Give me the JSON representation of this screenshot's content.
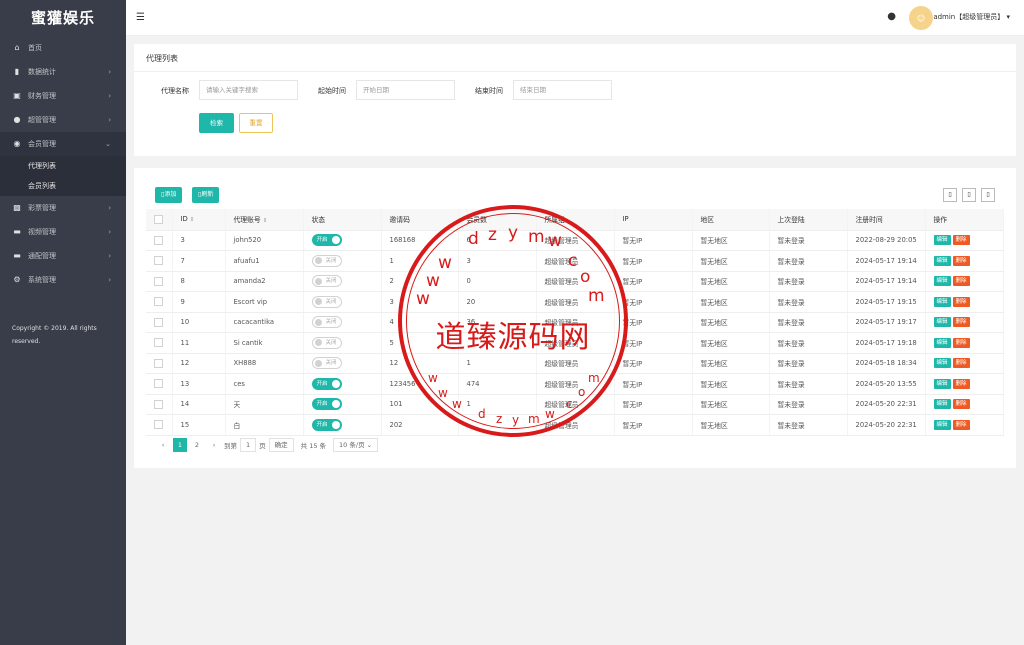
{
  "app": {
    "name": "蜜獾娱乐"
  },
  "sidebar": {
    "items": [
      {
        "label": "首页",
        "icon": "home-icon"
      },
      {
        "label": "数据统计",
        "icon": "bar-chart-icon"
      },
      {
        "label": "财务管理",
        "icon": "bank-icon"
      },
      {
        "label": "超管管理",
        "icon": "user-icon"
      },
      {
        "label": "会员管理",
        "icon": "users-icon"
      },
      {
        "label": "彩票管理",
        "icon": "gamepad-icon"
      },
      {
        "label": "视频管理",
        "icon": "video-icon"
      },
      {
        "label": "通配管理",
        "icon": "tag-icon"
      },
      {
        "label": "系统管理",
        "icon": "gear-icon"
      }
    ],
    "submenu": [
      "代理列表",
      "会员列表"
    ],
    "copyright": "Copyright © 2019. All rights reserved."
  },
  "header": {
    "user": "admin【超级管理员】"
  },
  "search": {
    "title": "代理列表",
    "name_label": "代理名称",
    "name_placeholder": "请输入关键字搜索",
    "start_label": "起始时间",
    "start_placeholder": "开始日期",
    "end_label": "结束时间",
    "end_placeholder": "结束日期",
    "search_btn": "检索",
    "reset_btn": "重置"
  },
  "toolbar": {
    "add": "添加",
    "refresh": "刷新"
  },
  "table": {
    "headers": [
      "ID",
      "代理账号",
      "状态",
      "邀请码",
      "会员数",
      "所属组",
      "IP",
      "地区",
      "上次登陆",
      "注册时间",
      "操作"
    ],
    "edit_label": "编辑",
    "delete_label": "删除",
    "rows": [
      {
        "id": "3",
        "account": "john520",
        "status": "开启",
        "on": true,
        "code": "168168",
        "members": "6",
        "group": "超级管理员",
        "ip": "暂无IP",
        "region": "暂无地区",
        "last": "暂未登录",
        "reg": "2022-08-29 20:05"
      },
      {
        "id": "7",
        "account": "afuafu1",
        "status": "关闭",
        "on": false,
        "code": "1",
        "members": "3",
        "group": "超级管理员",
        "ip": "暂无IP",
        "region": "暂无地区",
        "last": "暂未登录",
        "reg": "2024-05-17 19:14"
      },
      {
        "id": "8",
        "account": "amanda2",
        "status": "关闭",
        "on": false,
        "code": "2",
        "members": "0",
        "group": "超级管理员",
        "ip": "暂无IP",
        "region": "暂无地区",
        "last": "暂未登录",
        "reg": "2024-05-17 19:14"
      },
      {
        "id": "9",
        "account": "Escort vip",
        "status": "关闭",
        "on": false,
        "code": "3",
        "members": "20",
        "group": "超级管理员",
        "ip": "暂无IP",
        "region": "暂无地区",
        "last": "暂未登录",
        "reg": "2024-05-17 19:15"
      },
      {
        "id": "10",
        "account": "cacacantika",
        "status": "关闭",
        "on": false,
        "code": "4",
        "members": "36",
        "group": "超级管理员",
        "ip": "暂无IP",
        "region": "暂无地区",
        "last": "暂未登录",
        "reg": "2024-05-17 19:17"
      },
      {
        "id": "11",
        "account": "Si cantik",
        "status": "关闭",
        "on": false,
        "code": "5",
        "members": "",
        "group": "超级管理员",
        "ip": "暂无IP",
        "region": "暂无地区",
        "last": "暂未登录",
        "reg": "2024-05-17 19:18"
      },
      {
        "id": "12",
        "account": "XH888",
        "status": "关闭",
        "on": false,
        "code": "12",
        "members": "1",
        "group": "超级管理员",
        "ip": "暂无IP",
        "region": "暂无地区",
        "last": "暂未登录",
        "reg": "2024-05-18 18:34"
      },
      {
        "id": "13",
        "account": "ces",
        "status": "开启",
        "on": true,
        "code": "123456",
        "members": "474",
        "group": "超级管理员",
        "ip": "暂无IP",
        "region": "暂无地区",
        "last": "暂未登录",
        "reg": "2024-05-20 13:55"
      },
      {
        "id": "14",
        "account": "天",
        "status": "开启",
        "on": true,
        "code": "101",
        "members": "1",
        "group": "超级管理员",
        "ip": "暂无IP",
        "region": "暂无地区",
        "last": "暂未登录",
        "reg": "2024-05-20 22:31"
      },
      {
        "id": "15",
        "account": "白",
        "status": "开启",
        "on": true,
        "code": "202",
        "members": "",
        "group": "超级管理员",
        "ip": "暂无IP",
        "region": "暂无地区",
        "last": "暂未登录",
        "reg": "2024-05-20 22:31"
      }
    ]
  },
  "pagination": {
    "page1": "1",
    "page2": "2",
    "goto": "到第",
    "page_input": "1",
    "page_unit": "页",
    "confirm": "确定",
    "total": "共 15 条",
    "per_page": "10 条/页"
  },
  "watermark": {
    "text": "道臻源码网",
    "url": "www.dzymw.com"
  },
  "colors": {
    "sidebar": "#393d49",
    "accent": "#1fb7a9",
    "danger": "#ee5a24",
    "stamp": "#d91a1a"
  }
}
